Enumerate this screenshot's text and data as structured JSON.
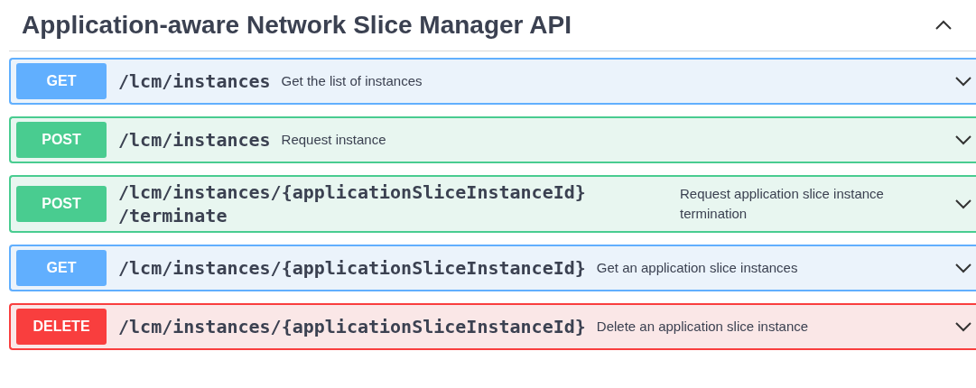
{
  "section": {
    "title": "Application-aware Network Slice Manager API",
    "expanded": true
  },
  "operations": [
    {
      "method": "GET",
      "path": "/lcm/instances",
      "summary": "Get the list of instances",
      "expanded": false
    },
    {
      "method": "POST",
      "path": "/lcm/instances",
      "summary": "Request instance",
      "expanded": false
    },
    {
      "method": "POST",
      "path": "/lcm/instances/{applicationSliceInstanceId}/terminate",
      "summary": "Request application slice instance termination",
      "expanded": false
    },
    {
      "method": "GET",
      "path": "/lcm/instances/{applicationSliceInstanceId}",
      "summary": "Get an application slice instances",
      "expanded": false
    },
    {
      "method": "DELETE",
      "path": "/lcm/instances/{applicationSliceInstanceId}",
      "summary": "Delete an application slice instance",
      "expanded": false
    }
  ]
}
